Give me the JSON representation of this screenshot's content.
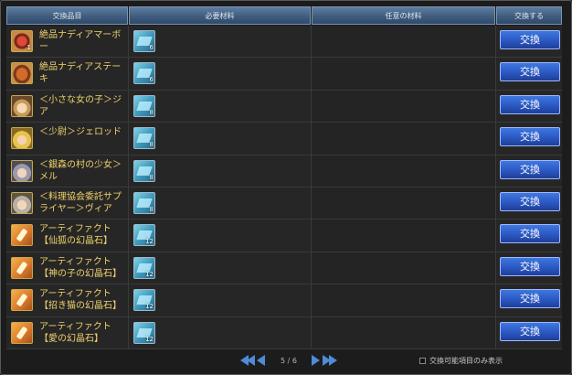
{
  "header": {
    "col1": "交換品目",
    "col2": "必要材料",
    "col3": "任意の材料",
    "col4": "交換する"
  },
  "rows": [
    {
      "name": "絶品ナディアマーボー",
      "item_count": "1",
      "icon": "food-dish-icon",
      "material_count": "6",
      "button": "交換"
    },
    {
      "name": "絶品ナディアステーキ",
      "item_count": "",
      "icon": "food-steak-icon",
      "material_count": "6",
      "button": "交換"
    },
    {
      "name": "＜小さな女の子＞ジア",
      "item_count": "",
      "icon": "character-portrait-icon",
      "material_count": "8",
      "button": "交換"
    },
    {
      "name": "＜少尉＞ジェロッド",
      "item_count": "",
      "icon": "character-portrait-icon",
      "material_count": "8",
      "button": "交換"
    },
    {
      "name": "＜銀森の村の少女＞メル",
      "item_count": "",
      "icon": "character-portrait-icon",
      "material_count": "8",
      "button": "交換"
    },
    {
      "name": "＜料理協会委託サプライヤー＞ヴィア",
      "item_count": "",
      "icon": "character-portrait-icon",
      "material_count": "8",
      "button": "交換"
    },
    {
      "name": "アーティファクト【仙狐の幻晶石】",
      "item_count": "",
      "icon": "crystal-icon",
      "material_count": "12",
      "button": "交換"
    },
    {
      "name": "アーティファクト【神の子の幻晶石】",
      "item_count": "",
      "icon": "crystal-icon",
      "material_count": "12",
      "button": "交換"
    },
    {
      "name": "アーティファクト【招き猫の幻晶石】",
      "item_count": "",
      "icon": "crystal-icon",
      "material_count": "12",
      "button": "交換"
    },
    {
      "name": "アーティファクト【愛の幻晶石】",
      "item_count": "",
      "icon": "crystal-icon",
      "material_count": "12",
      "button": "交換"
    }
  ],
  "pagination": {
    "current": "5",
    "total": "6",
    "text": "5 / 6"
  },
  "filter": {
    "label": "交換可能項目のみ表示",
    "checked": false
  },
  "colors": {
    "button": "#2b58c2",
    "header": "#3d5a7c",
    "item_text": "#f0d36c"
  }
}
